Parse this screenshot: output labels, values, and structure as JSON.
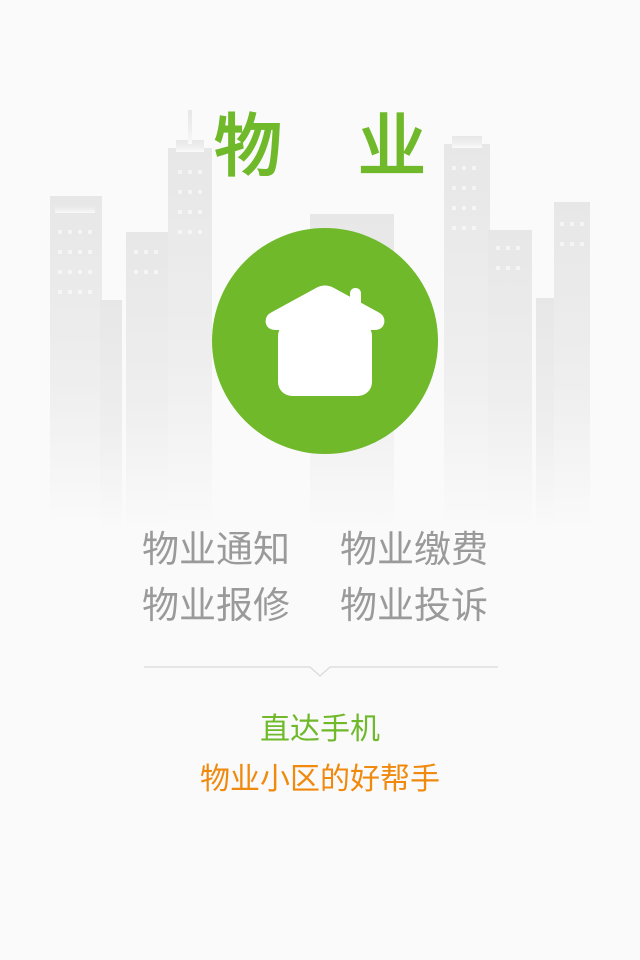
{
  "theme": {
    "green": "#6fb92b",
    "orange": "#f08a0e",
    "gray": "#9a9a9a"
  },
  "header": {
    "title": "物 业"
  },
  "logo": {
    "icon": "house-icon"
  },
  "features": [
    [
      "物业通知",
      "物业缴费"
    ],
    [
      "物业报修",
      "物业投诉"
    ]
  ],
  "tagline": {
    "line1": "直达手机",
    "line2": "物业小区的好帮手"
  }
}
